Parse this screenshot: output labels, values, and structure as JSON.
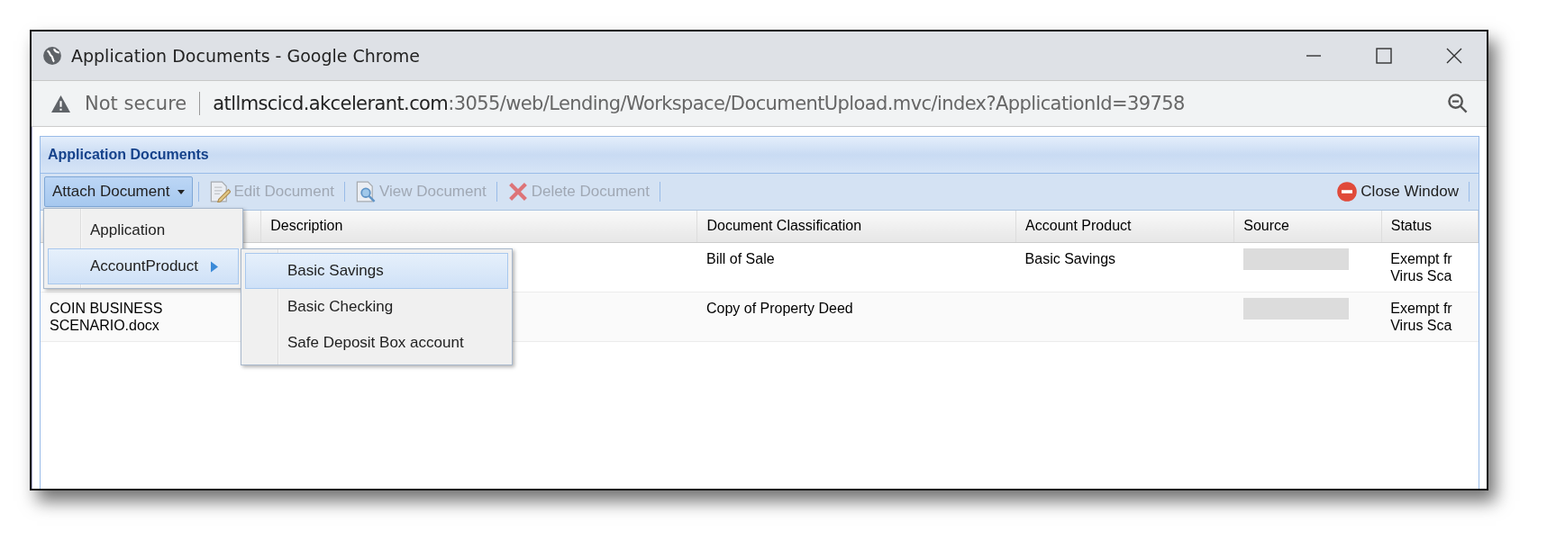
{
  "window": {
    "title": "Application Documents - Google Chrome"
  },
  "address_bar": {
    "security": "Not secure",
    "host": "atllmscicd.akcelerant.com",
    "path": ":3055/web/Lending/Workspace/DocumentUpload.mvc/index?ApplicationId=39758"
  },
  "panel": {
    "title": "Application Documents"
  },
  "toolbar": [
    {
      "label": "Attach Document",
      "kind": "dropdown",
      "disabled": false,
      "expanded": true
    },
    {
      "label": "Edit Document",
      "kind": "edit",
      "disabled": true
    },
    {
      "label": "View Document",
      "kind": "view",
      "disabled": true
    },
    {
      "label": "Delete Document",
      "kind": "delete",
      "disabled": true
    },
    {
      "label": "Close Window",
      "kind": "close",
      "disabled": false
    }
  ],
  "table": {
    "columns": [
      "Description",
      "Document Classification",
      "Account Product",
      "Source",
      "Status"
    ],
    "rows": [
      {
        "name": "",
        "classification": "Bill of Sale",
        "account_product": "Basic Savings",
        "status": [
          "Exempt fr",
          "Virus Sca"
        ]
      },
      {
        "name": "COIN BUSINESS SCENARIO.docx",
        "classification": "Copy of Property Deed",
        "account_product": "",
        "status": [
          "Exempt fr",
          "Virus Sca"
        ]
      }
    ]
  },
  "menu": {
    "items": [
      {
        "label": "Application",
        "selected": false,
        "has_submenu": false
      },
      {
        "label": "AccountProduct",
        "selected": true,
        "has_submenu": true
      }
    ]
  },
  "submenu": {
    "items": [
      {
        "label": "Basic Savings",
        "selected": true
      },
      {
        "label": "Basic Checking",
        "selected": false
      },
      {
        "label": "Safe Deposit Box account",
        "selected": false
      }
    ]
  }
}
